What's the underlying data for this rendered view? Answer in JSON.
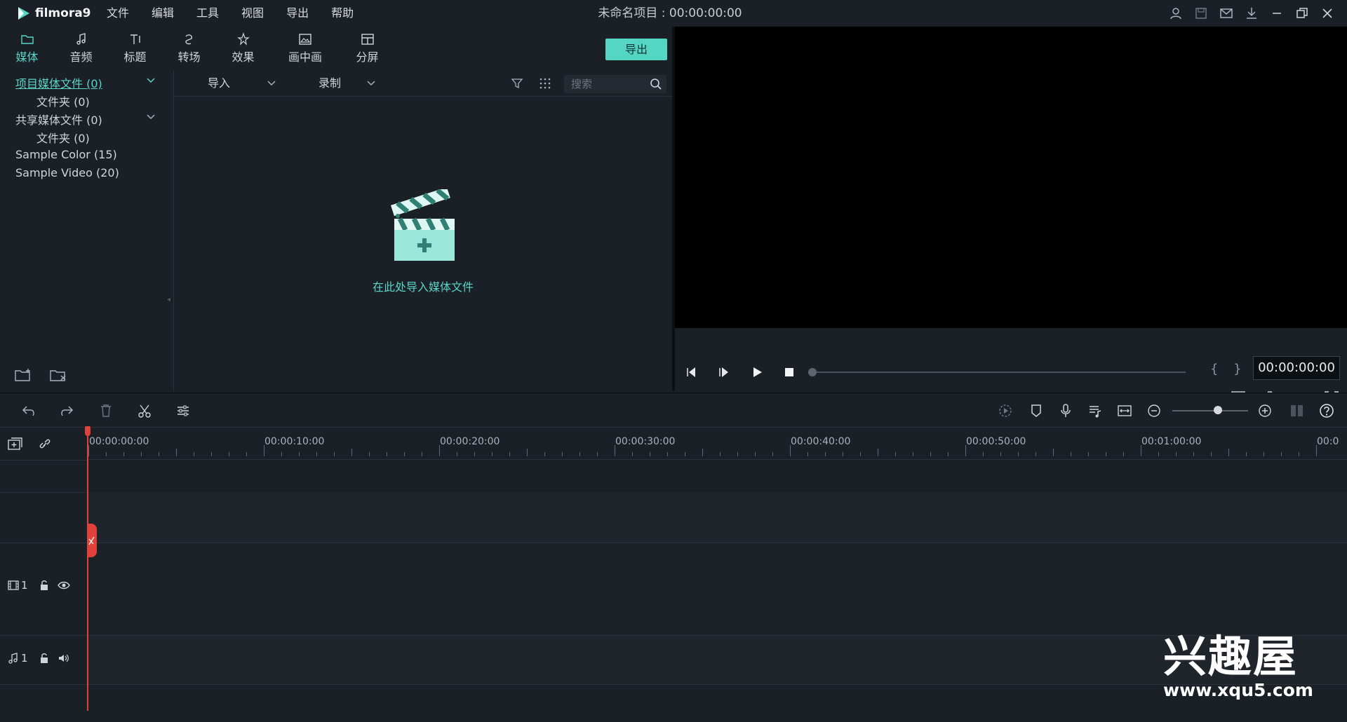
{
  "app": {
    "logo_text": "filmora9",
    "project_title": "未命名项目 : 00:00:00:00"
  },
  "menu": [
    "文件",
    "编辑",
    "工具",
    "视图",
    "导出",
    "帮助"
  ],
  "tabs": [
    {
      "label": "媒体",
      "icon": "folder-icon",
      "active": true
    },
    {
      "label": "音频",
      "icon": "music-note-icon"
    },
    {
      "label": "标题",
      "icon": "title-text-icon"
    },
    {
      "label": "转场",
      "icon": "transition-icon"
    },
    {
      "label": "效果",
      "icon": "effects-icon"
    },
    {
      "label": "画中画",
      "icon": "picture-in-picture-icon"
    },
    {
      "label": "分屏",
      "icon": "split-screen-icon"
    }
  ],
  "export_button": "导出",
  "library": {
    "items": [
      {
        "label": "项目媒体文件 (0)",
        "active": true
      },
      {
        "label": "文件夹 (0)"
      },
      {
        "label": "共享媒体文件 (0)"
      },
      {
        "label": "文件夹 (0)"
      },
      {
        "label": "Sample Color (15)"
      },
      {
        "label": "Sample Video (20)"
      }
    ]
  },
  "media_toolbar": {
    "import_label": "导入",
    "record_label": "录制",
    "search_placeholder": "搜索"
  },
  "media_empty_text": "在此处导入媒体文件",
  "preview": {
    "timecode": "00:00:00:00",
    "braces": "{ }"
  },
  "timeline": {
    "ruler_labels": [
      "00:00:00:00",
      "00:00:10:00",
      "00:00:20:00",
      "00:00:30:00",
      "00:00:40:00",
      "00:00:50:00",
      "00:01:00:00",
      "00:0"
    ],
    "video_track_label": "1",
    "audio_track_label": "1"
  },
  "watermark": {
    "title": "兴趣屋",
    "url": "www.xqu5.com"
  },
  "colors": {
    "accent": "#55d5c4",
    "playhead": "#e0413a",
    "background": "#1b2026"
  }
}
